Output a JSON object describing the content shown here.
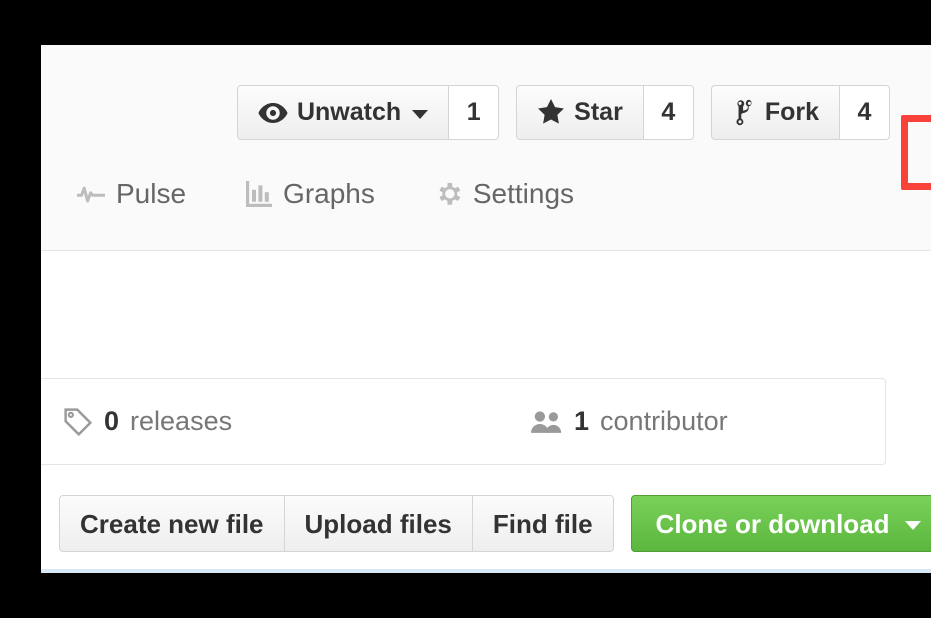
{
  "page": {
    "title": "GitHub repository page fragment",
    "background_color": "#000000",
    "card_background": "#ffffff",
    "header_background": "#fafafa",
    "highlight_color": "#f9423a",
    "accent_green": "#6cc644",
    "bottom_rule_color": "#d9e7f2"
  },
  "actions": {
    "watch": {
      "label": "Unwatch",
      "count": "1",
      "icon": "eye-icon",
      "has_caret": true
    },
    "star": {
      "label": "Star",
      "count": "4",
      "icon": "star-icon",
      "has_caret": false
    },
    "fork": {
      "label": "Fork",
      "count": "4",
      "icon": "repo-forked-icon",
      "has_caret": false,
      "highlighted": true
    }
  },
  "nav": {
    "items": [
      {
        "label": "Pulse",
        "icon": "pulse-icon"
      },
      {
        "label": "Graphs",
        "icon": "graph-icon"
      },
      {
        "label": "Settings",
        "icon": "gear-icon"
      }
    ]
  },
  "numbers": {
    "releases": {
      "count": "0",
      "label": "releases",
      "icon": "tag-icon"
    },
    "contributors": {
      "count": "1",
      "label": "contributor",
      "icon": "people-icon"
    }
  },
  "file_actions": {
    "create_new_file": "Create new file",
    "upload_files": "Upload files",
    "find_file": "Find file",
    "clone_or_download": "Clone or download"
  }
}
